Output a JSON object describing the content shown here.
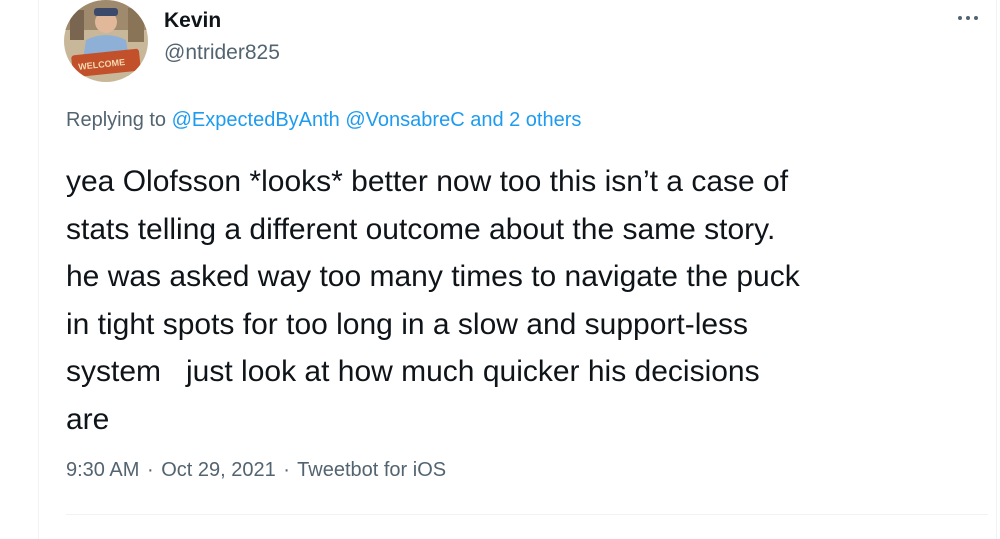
{
  "author": {
    "display_name": "Kevin",
    "handle": "@ntrider825",
    "avatar_sign_text": "WELCOME"
  },
  "reply": {
    "prefix": "Replying to",
    "mentions": [
      "@ExpectedByAnth",
      "@VonsabreC"
    ],
    "suffix": "and 2 others"
  },
  "tweet": {
    "lines": [
      "yea Olofsson *looks* better now too this isn’t a case of",
      "stats telling a different outcome about the same story.",
      "he was asked way too many times to navigate the puck",
      "in tight spots for too long in a slow and support-less",
      "system   just look at how much quicker his decisions",
      "are"
    ]
  },
  "meta": {
    "time": "9:30 AM",
    "date": "Oct 29, 2021",
    "separator": "·",
    "source": "Tweetbot for iOS"
  },
  "colors": {
    "link": "#1d9bf0",
    "secondary_text": "#536471",
    "primary_text": "#0f1419"
  },
  "icons": {
    "more": "more-horizontal-icon"
  }
}
